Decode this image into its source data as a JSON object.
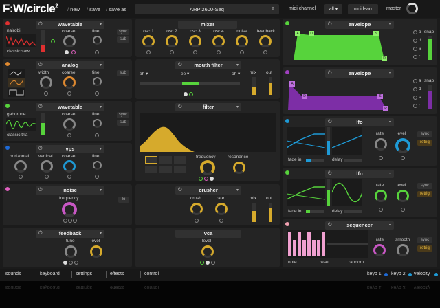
{
  "header": {
    "logo": "F:W/circle",
    "logo_sup": "2",
    "new": "new",
    "save": "save",
    "save_as": "save as",
    "preset": "ARP 2600-Seq",
    "midi_channel_label": "midi channel",
    "midi_channel_value": "all",
    "midi_learn": "midi learn",
    "master": "master"
  },
  "osc1": {
    "title": "wavetable",
    "wave_top": "nairobi",
    "wave_bottom": "classic saw",
    "coarse": "coarse",
    "fine": "fine",
    "sync": "sync",
    "sub": "sub"
  },
  "analog": {
    "title": "analog",
    "width": "width",
    "coarse": "coarse",
    "fine": "fine",
    "sub": "sub"
  },
  "osc3": {
    "title": "wavetable",
    "wave_top": "gaborone",
    "wave_bottom": "classic tria",
    "coarse": "coarse",
    "fine": "fine",
    "sync": "sync",
    "sub": "sub"
  },
  "vps": {
    "title": "vps",
    "horizontal": "horizontal",
    "vertical": "vertical",
    "coarse": "coarse",
    "fine": "fine"
  },
  "noise": {
    "title": "noise",
    "frequency": "frequency",
    "lo": "lo"
  },
  "feedback": {
    "title": "feedback",
    "tune": "tune",
    "level": "level"
  },
  "mixer": {
    "title": "mixer",
    "knobs": [
      "osc 1",
      "osc 2",
      "osc 3",
      "osc 4",
      "noise",
      "feedback"
    ]
  },
  "mouth_filter": {
    "title": "mouth filter",
    "v1": "ah",
    "v2": "ee",
    "v3": "oh",
    "mix": "mix",
    "out": "out"
  },
  "filter": {
    "title": "filter",
    "frequency": "frequency",
    "resonance": "resonance"
  },
  "crusher": {
    "title": "crusher",
    "crush": "crush",
    "rate": "rate",
    "mix": "mix",
    "out": "out"
  },
  "vca": {
    "title": "vca",
    "level": "level"
  },
  "env1": {
    "title": "envelope",
    "snap": "snap",
    "a": "a",
    "d": "d",
    "s": "s",
    "r": "r",
    "nodes": [
      "A",
      "D",
      "S",
      "R"
    ]
  },
  "env2": {
    "title": "envelope",
    "snap": "snap",
    "a": "a",
    "d": "d",
    "s": "s",
    "r": "r",
    "nodes": [
      "A",
      "D",
      "S",
      "R"
    ]
  },
  "lfo1": {
    "title": "lfo",
    "fade_in": "fade in",
    "delay": "delay",
    "rate": "rate",
    "level": "level",
    "sync": "sync",
    "retrig": "retrig"
  },
  "lfo2": {
    "title": "lfo",
    "fade_in": "fade in",
    "delay": "delay",
    "rate": "rate",
    "level": "level",
    "sync": "sync",
    "retrig": "retrig"
  },
  "sequencer": {
    "title": "sequencer",
    "note": "note",
    "reset": "reset",
    "random": "random",
    "rate": "rate",
    "smooth": "smooth",
    "sync": "sync",
    "retrig": "retrig"
  },
  "bottom": {
    "sounds": "sounds",
    "keyboard": "keyboard",
    "settings": "settings",
    "effects": "effects",
    "control": "control",
    "key1": "keyb 1",
    "key2": "keyb 2",
    "velocity": "velocity"
  },
  "colors": {
    "yellow": "#d6aa2c",
    "green": "#57d33c",
    "purple": "#7d2ea6",
    "blue": "#1e9ad6",
    "pink": "#e060c0",
    "orange": "#e08a30",
    "red": "#e03030"
  }
}
